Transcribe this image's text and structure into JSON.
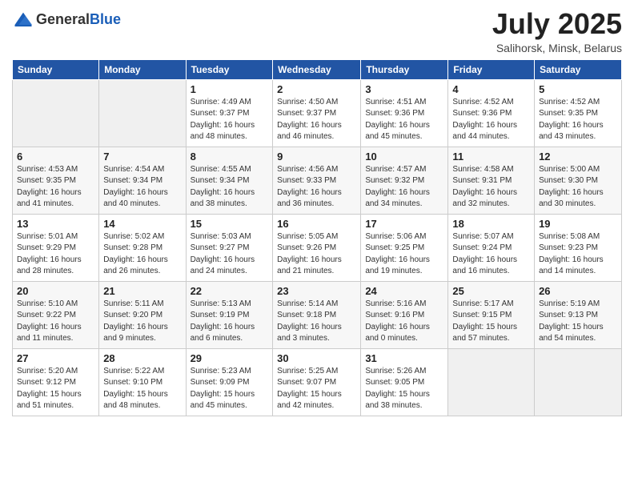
{
  "header": {
    "logo_general": "General",
    "logo_blue": "Blue",
    "month": "July 2025",
    "location": "Salihorsk, Minsk, Belarus"
  },
  "weekdays": [
    "Sunday",
    "Monday",
    "Tuesday",
    "Wednesday",
    "Thursday",
    "Friday",
    "Saturday"
  ],
  "weeks": [
    [
      {
        "day": "",
        "info": ""
      },
      {
        "day": "",
        "info": ""
      },
      {
        "day": "1",
        "info": "Sunrise: 4:49 AM\nSunset: 9:37 PM\nDaylight: 16 hours\nand 48 minutes."
      },
      {
        "day": "2",
        "info": "Sunrise: 4:50 AM\nSunset: 9:37 PM\nDaylight: 16 hours\nand 46 minutes."
      },
      {
        "day": "3",
        "info": "Sunrise: 4:51 AM\nSunset: 9:36 PM\nDaylight: 16 hours\nand 45 minutes."
      },
      {
        "day": "4",
        "info": "Sunrise: 4:52 AM\nSunset: 9:36 PM\nDaylight: 16 hours\nand 44 minutes."
      },
      {
        "day": "5",
        "info": "Sunrise: 4:52 AM\nSunset: 9:35 PM\nDaylight: 16 hours\nand 43 minutes."
      }
    ],
    [
      {
        "day": "6",
        "info": "Sunrise: 4:53 AM\nSunset: 9:35 PM\nDaylight: 16 hours\nand 41 minutes."
      },
      {
        "day": "7",
        "info": "Sunrise: 4:54 AM\nSunset: 9:34 PM\nDaylight: 16 hours\nand 40 minutes."
      },
      {
        "day": "8",
        "info": "Sunrise: 4:55 AM\nSunset: 9:34 PM\nDaylight: 16 hours\nand 38 minutes."
      },
      {
        "day": "9",
        "info": "Sunrise: 4:56 AM\nSunset: 9:33 PM\nDaylight: 16 hours\nand 36 minutes."
      },
      {
        "day": "10",
        "info": "Sunrise: 4:57 AM\nSunset: 9:32 PM\nDaylight: 16 hours\nand 34 minutes."
      },
      {
        "day": "11",
        "info": "Sunrise: 4:58 AM\nSunset: 9:31 PM\nDaylight: 16 hours\nand 32 minutes."
      },
      {
        "day": "12",
        "info": "Sunrise: 5:00 AM\nSunset: 9:30 PM\nDaylight: 16 hours\nand 30 minutes."
      }
    ],
    [
      {
        "day": "13",
        "info": "Sunrise: 5:01 AM\nSunset: 9:29 PM\nDaylight: 16 hours\nand 28 minutes."
      },
      {
        "day": "14",
        "info": "Sunrise: 5:02 AM\nSunset: 9:28 PM\nDaylight: 16 hours\nand 26 minutes."
      },
      {
        "day": "15",
        "info": "Sunrise: 5:03 AM\nSunset: 9:27 PM\nDaylight: 16 hours\nand 24 minutes."
      },
      {
        "day": "16",
        "info": "Sunrise: 5:05 AM\nSunset: 9:26 PM\nDaylight: 16 hours\nand 21 minutes."
      },
      {
        "day": "17",
        "info": "Sunrise: 5:06 AM\nSunset: 9:25 PM\nDaylight: 16 hours\nand 19 minutes."
      },
      {
        "day": "18",
        "info": "Sunrise: 5:07 AM\nSunset: 9:24 PM\nDaylight: 16 hours\nand 16 minutes."
      },
      {
        "day": "19",
        "info": "Sunrise: 5:08 AM\nSunset: 9:23 PM\nDaylight: 16 hours\nand 14 minutes."
      }
    ],
    [
      {
        "day": "20",
        "info": "Sunrise: 5:10 AM\nSunset: 9:22 PM\nDaylight: 16 hours\nand 11 minutes."
      },
      {
        "day": "21",
        "info": "Sunrise: 5:11 AM\nSunset: 9:20 PM\nDaylight: 16 hours\nand 9 minutes."
      },
      {
        "day": "22",
        "info": "Sunrise: 5:13 AM\nSunset: 9:19 PM\nDaylight: 16 hours\nand 6 minutes."
      },
      {
        "day": "23",
        "info": "Sunrise: 5:14 AM\nSunset: 9:18 PM\nDaylight: 16 hours\nand 3 minutes."
      },
      {
        "day": "24",
        "info": "Sunrise: 5:16 AM\nSunset: 9:16 PM\nDaylight: 16 hours\nand 0 minutes."
      },
      {
        "day": "25",
        "info": "Sunrise: 5:17 AM\nSunset: 9:15 PM\nDaylight: 15 hours\nand 57 minutes."
      },
      {
        "day": "26",
        "info": "Sunrise: 5:19 AM\nSunset: 9:13 PM\nDaylight: 15 hours\nand 54 minutes."
      }
    ],
    [
      {
        "day": "27",
        "info": "Sunrise: 5:20 AM\nSunset: 9:12 PM\nDaylight: 15 hours\nand 51 minutes."
      },
      {
        "day": "28",
        "info": "Sunrise: 5:22 AM\nSunset: 9:10 PM\nDaylight: 15 hours\nand 48 minutes."
      },
      {
        "day": "29",
        "info": "Sunrise: 5:23 AM\nSunset: 9:09 PM\nDaylight: 15 hours\nand 45 minutes."
      },
      {
        "day": "30",
        "info": "Sunrise: 5:25 AM\nSunset: 9:07 PM\nDaylight: 15 hours\nand 42 minutes."
      },
      {
        "day": "31",
        "info": "Sunrise: 5:26 AM\nSunset: 9:05 PM\nDaylight: 15 hours\nand 38 minutes."
      },
      {
        "day": "",
        "info": ""
      },
      {
        "day": "",
        "info": ""
      }
    ]
  ]
}
